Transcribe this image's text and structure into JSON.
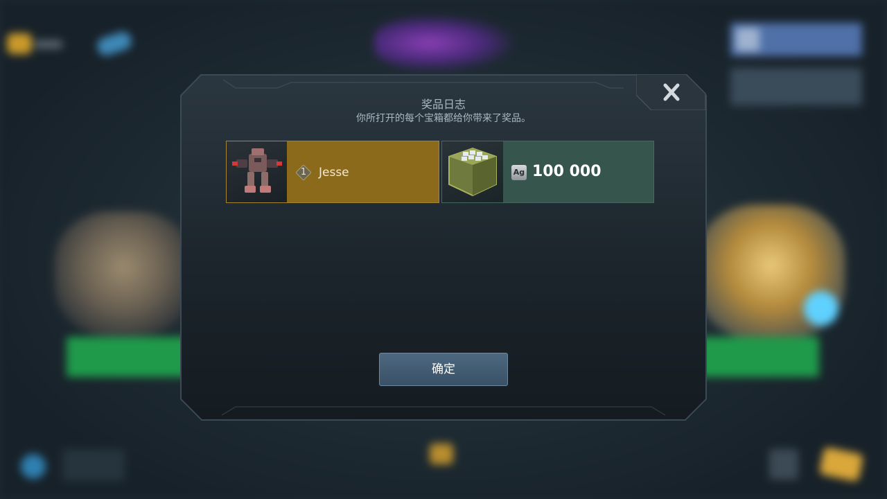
{
  "modal": {
    "title": "奖品日志",
    "subtitle": "你所打开的每个宝箱都给你带来了奖品。",
    "close_icon": "close-x-icon",
    "confirm_label": "确定"
  },
  "rewards": [
    {
      "type": "robot",
      "icon": "robot-mech-icon",
      "level": "1",
      "name": "Jesse",
      "bg_color": "#8c6a1c"
    },
    {
      "type": "silver",
      "icon": "silver-crate-icon",
      "currency_badge": "Ag",
      "amount": "100 000",
      "bg_color": "#35554d"
    }
  ]
}
